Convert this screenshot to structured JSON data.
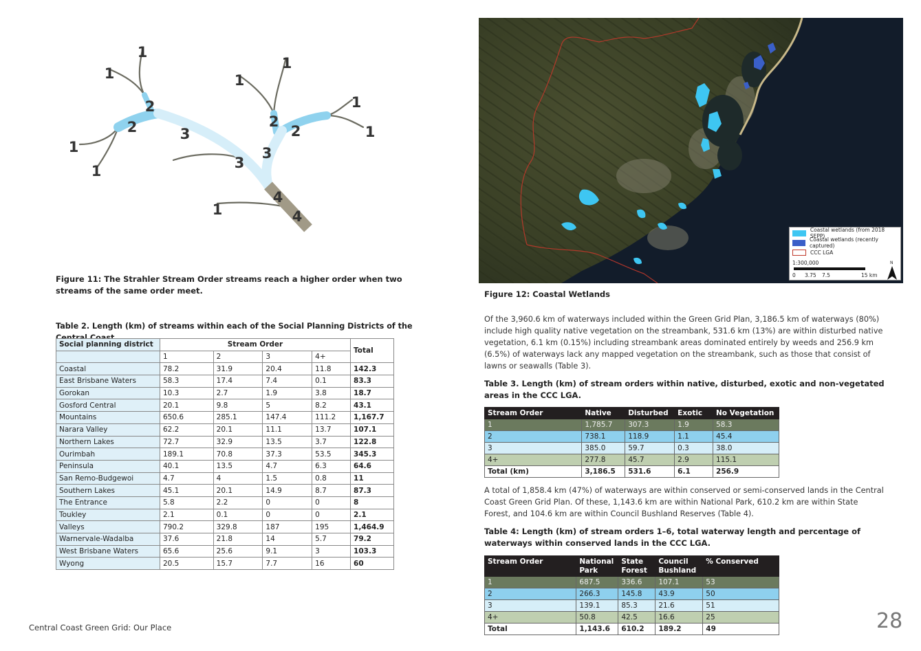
{
  "figure11": {
    "labels": [
      "1",
      "1",
      "1",
      "1",
      "1",
      "1",
      "1",
      "1",
      "1",
      "2",
      "2",
      "2",
      "2",
      "3",
      "3",
      "3",
      "4",
      "4"
    ],
    "caption": "Figure 11: The Strahler Stream Order streams reach a higher order when two streams of the same order meet."
  },
  "figure12": {
    "caption": "Figure 12: Coastal Wetlands",
    "legend": {
      "item1": "Coastal wetlands (from 2018 SEPP)",
      "item2": "Coastal wetlands (recently captured)",
      "item3": "CCC LGA",
      "scale": "1:300,000",
      "ticks": [
        "0",
        "3.75",
        "7.5",
        "15 km"
      ],
      "north": "N"
    },
    "colors": {
      "sepp": "#3ec6f2",
      "recent": "#3a5fc8",
      "lga": "#c0392b"
    }
  },
  "table2": {
    "title": "Table 2. Length (km) of streams within each of the Social Planning Districts of the Central Coast",
    "col_district": "Social planning district",
    "col_stream_order": "Stream Order",
    "col_total": "Total",
    "subcols": [
      "1",
      "2",
      "3",
      "4+"
    ],
    "rows": [
      {
        "d": "Coastal",
        "v": [
          "78.2",
          "31.9",
          "20.4",
          "11.8"
        ],
        "t": "142.3"
      },
      {
        "d": "East Brisbane Waters",
        "v": [
          "58.3",
          "17.4",
          "7.4",
          "0.1"
        ],
        "t": "83.3"
      },
      {
        "d": "Gorokan",
        "v": [
          "10.3",
          "2.7",
          "1.9",
          "3.8"
        ],
        "t": "18.7"
      },
      {
        "d": "Gosford Central",
        "v": [
          "20.1",
          "9.8",
          "5",
          "8.2"
        ],
        "t": "43.1"
      },
      {
        "d": "Mountains",
        "v": [
          "650.6",
          "285.1",
          "147.4",
          "111.2"
        ],
        "t": "1,167.7"
      },
      {
        "d": "Narara Valley",
        "v": [
          "62.2",
          "20.1",
          "11.1",
          "13.7"
        ],
        "t": "107.1"
      },
      {
        "d": "Northern Lakes",
        "v": [
          "72.7",
          "32.9",
          "13.5",
          "3.7"
        ],
        "t": "122.8"
      },
      {
        "d": "Ourimbah",
        "v": [
          "189.1",
          "70.8",
          "37.3",
          "53.5"
        ],
        "t": "345.3"
      },
      {
        "d": "Peninsula",
        "v": [
          "40.1",
          "13.5",
          "4.7",
          "6.3"
        ],
        "t": "64.6"
      },
      {
        "d": "San Remo-Budgewoi",
        "v": [
          "4.7",
          "4",
          "1.5",
          "0.8"
        ],
        "t": "11"
      },
      {
        "d": "Southern Lakes",
        "v": [
          "45.1",
          "20.1",
          "14.9",
          "8.7"
        ],
        "t": "87.3"
      },
      {
        "d": "The Entrance",
        "v": [
          "5.8",
          "2.2",
          "0",
          "0"
        ],
        "t": "8"
      },
      {
        "d": "Toukley",
        "v": [
          "2.1",
          "0.1",
          "0",
          "0"
        ],
        "t": "2.1"
      },
      {
        "d": "Valleys",
        "v": [
          "790.2",
          "329.8",
          "187",
          "195"
        ],
        "t": "1,464.9"
      },
      {
        "d": "Warnervale-Wadalba",
        "v": [
          "37.6",
          "21.8",
          "14",
          "5.7"
        ],
        "t": "79.2"
      },
      {
        "d": "West Brisbane Waters",
        "v": [
          "65.6",
          "25.6",
          "9.1",
          "3"
        ],
        "t": "103.3"
      },
      {
        "d": "Wyong",
        "v": [
          "20.5",
          "15.7",
          "7.7",
          "16"
        ],
        "t": "60"
      }
    ]
  },
  "para1": "Of the 3,960.6 km of waterways included within the Green Grid Plan, 3,186.5 km of waterways (80%) include high quality native vegetation on the streambank, 531.6 km (13%) are within disturbed native vegetation, 6.1 km (0.15%) including streambank areas dominated entirely by weeds and 256.9 km (6.5%) of waterways lack any mapped vegetation on the streambank, such as those that consist of lawns or seawalls (Table 3).",
  "table3": {
    "title": "Table 3. Length (km) of stream orders within native, disturbed, exotic and non-vegetated areas in the CCC LGA.",
    "headers": [
      "Stream Order",
      "Native",
      "Disturbed",
      "Exotic",
      "No Vegetation"
    ],
    "rows": [
      [
        "1",
        "1,785.7",
        "307.3",
        "1.9",
        "58.3"
      ],
      [
        "2",
        "738.1",
        "118.9",
        "1.1",
        "45.4"
      ],
      [
        "3",
        "385.0",
        "59.7",
        "0.3",
        "38.0"
      ],
      [
        "4+",
        "277.8",
        "45.7",
        "2.9",
        "115.1"
      ],
      [
        "Total (km)",
        "3,186.5",
        "531.6",
        "6.1",
        "256.9"
      ]
    ]
  },
  "para2": "A total of 1,858.4 km (47%) of waterways are within conserved or semi-conserved lands in the Central Coast Green Grid Plan. Of these, 1,143.6 km are within National Park, 610.2 km are within State Forest, and 104.6 km are within Council Bushland Reserves (Table 4).",
  "table4": {
    "title": "Table 4: Length (km) of stream orders 1–6, total waterway length and percentage of waterways within conserved lands in the CCC LGA.",
    "headers": [
      "Stream Order",
      "National Park",
      "State Forest",
      "Council Bushland",
      "% Conserved"
    ],
    "rows": [
      [
        "1",
        "687.5",
        "336.6",
        "107.1",
        "53"
      ],
      [
        "2",
        "266.3",
        "145.8",
        "43.9",
        "50"
      ],
      [
        "3",
        "139.1",
        "85.3",
        "21.6",
        "51"
      ],
      [
        "4+",
        "50.8",
        "42.5",
        "16.6",
        "25"
      ],
      [
        "Total",
        "1,143.6",
        "610.2",
        "189.2",
        "49"
      ]
    ]
  },
  "footer": "Central Coast Green Grid: Our Place",
  "page_number": "28"
}
